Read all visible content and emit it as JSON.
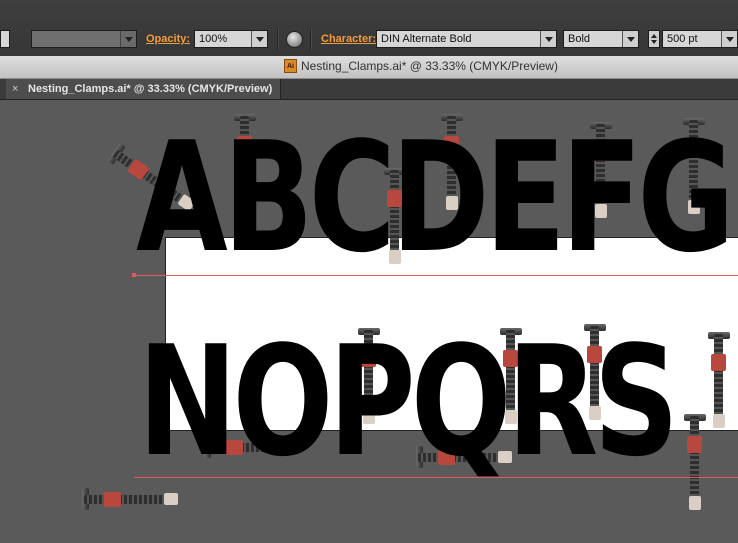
{
  "control_bar": {
    "opacity_label": "Opacity:",
    "opacity_value": "100%",
    "character_label": "Character:",
    "font_family": "DIN Alternate Bold",
    "font_style": "Bold",
    "font_size": "500 pt",
    "globe_icon": "recolor-globe-icon"
  },
  "window": {
    "title": "Nesting_Clamps.ai* @ 33.33% (CMYK/Preview)",
    "file_badge": "Ai"
  },
  "doc_tab": {
    "close_glyph": "×",
    "label": "Nesting_Clamps.ai* @ 33.33% (CMYK/Preview)"
  },
  "artwork": {
    "line1": "ABCDEFG",
    "line2": "NOPQRS",
    "clamp_icon": "bar-clamp-icon",
    "colors": {
      "type": "#000000",
      "guide": "#e05a5a",
      "clamp_grip": "#b8473e",
      "pasteboard": "#5a5a5a"
    }
  }
}
